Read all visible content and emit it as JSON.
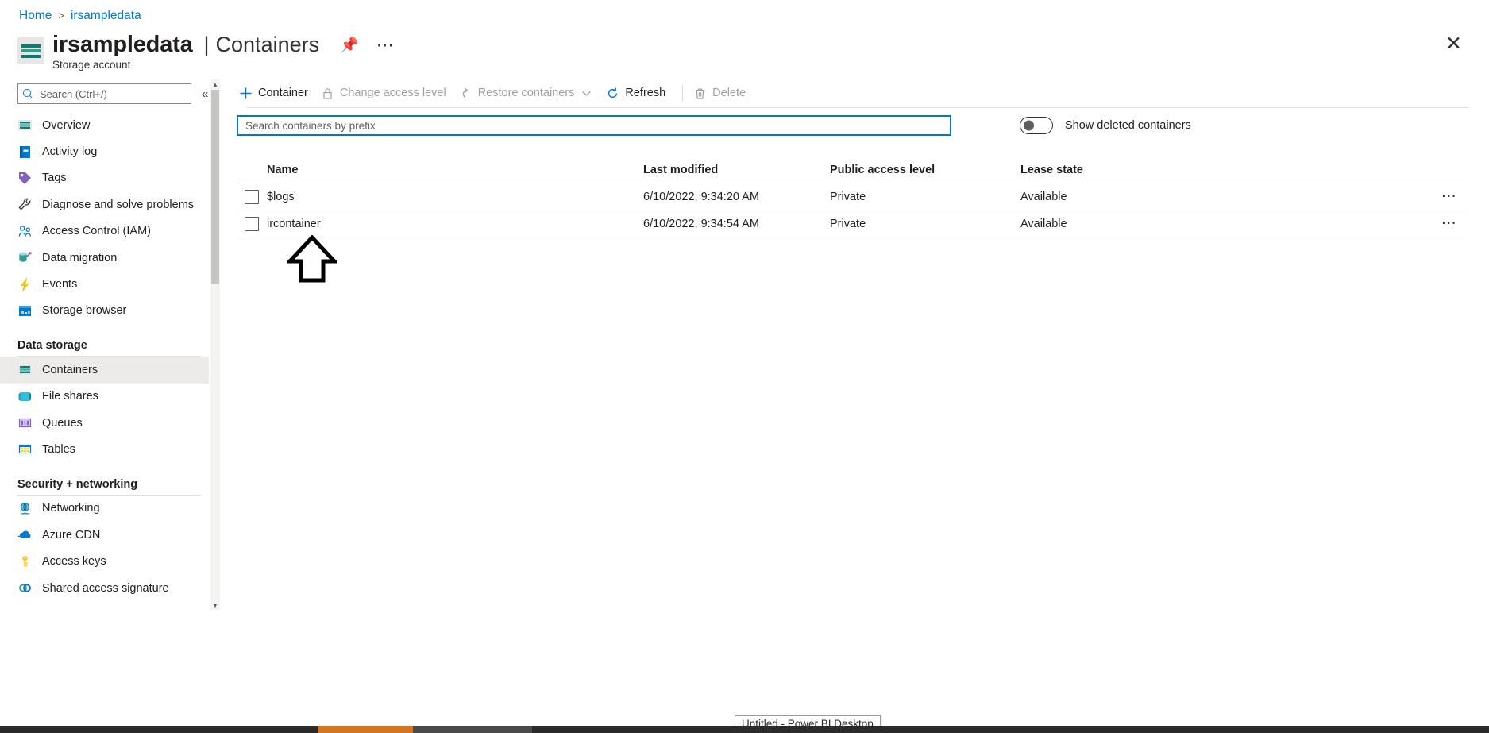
{
  "breadcrumb": {
    "home": "Home",
    "separator": ">",
    "current": "irsampledata"
  },
  "header": {
    "resource_name": "irsampledata",
    "pipe": "|",
    "page_title": "Containers",
    "subtitle": "Storage account",
    "pin_icon": "pin-icon",
    "more_icon": "ellipsis-icon",
    "close_icon": "close-icon"
  },
  "left_nav": {
    "search_placeholder": "Search (Ctrl+/)",
    "search_value": "",
    "collapse_icon": "chevron-double-left-icon",
    "items": [
      {
        "label": "Overview",
        "icon": "overview-icon",
        "selected": false
      },
      {
        "label": "Activity log",
        "icon": "activity-log-icon",
        "selected": false
      },
      {
        "label": "Tags",
        "icon": "tag-icon",
        "selected": false
      },
      {
        "label": "Diagnose and solve problems",
        "icon": "wrench-icon",
        "selected": false
      },
      {
        "label": "Access Control (IAM)",
        "icon": "people-icon",
        "selected": false
      },
      {
        "label": "Data migration",
        "icon": "data-migration-icon",
        "selected": false
      },
      {
        "label": "Events",
        "icon": "lightning-icon",
        "selected": false
      },
      {
        "label": "Storage browser",
        "icon": "storage-browser-icon",
        "selected": false
      }
    ],
    "groups": [
      {
        "title": "Data storage",
        "items": [
          {
            "label": "Containers",
            "icon": "containers-icon",
            "selected": true
          },
          {
            "label": "File shares",
            "icon": "file-share-icon",
            "selected": false
          },
          {
            "label": "Queues",
            "icon": "queues-icon",
            "selected": false
          },
          {
            "label": "Tables",
            "icon": "tables-icon",
            "selected": false
          }
        ]
      },
      {
        "title": "Security + networking",
        "items": [
          {
            "label": "Networking",
            "icon": "networking-icon",
            "selected": false
          },
          {
            "label": "Azure CDN",
            "icon": "cloud-icon",
            "selected": false
          },
          {
            "label": "Access keys",
            "icon": "key-icon",
            "selected": false
          },
          {
            "label": "Shared access signature",
            "icon": "link-icon",
            "selected": false
          }
        ]
      }
    ]
  },
  "command_bar": {
    "buttons": [
      {
        "label": "Container",
        "icon": "plus-icon",
        "disabled": false
      },
      {
        "label": "Change access level",
        "icon": "lock-icon",
        "disabled": true
      },
      {
        "label": "Restore containers",
        "icon": "undo-icon",
        "disabled": true,
        "has_chevron": true
      },
      {
        "label": "Refresh",
        "icon": "refresh-icon",
        "disabled": false
      },
      {
        "label": "Delete",
        "icon": "trash-icon",
        "disabled": true
      }
    ]
  },
  "filter_row": {
    "search_placeholder": "Search containers by prefix",
    "search_value": "",
    "toggle_label": "Show deleted containers",
    "toggle_on": false
  },
  "table": {
    "columns": [
      "Name",
      "Last modified",
      "Public access level",
      "Lease state"
    ],
    "rows": [
      {
        "name": "$logs",
        "last_modified": "6/10/2022, 9:34:20 AM",
        "public_access_level": "Private",
        "lease_state": "Available",
        "more_icon": "ellipsis-icon",
        "checked": false
      },
      {
        "name": "ircontainer",
        "last_modified": "6/10/2022, 9:34:54 AM",
        "public_access_level": "Private",
        "lease_state": "Available",
        "more_icon": "ellipsis-icon",
        "checked": false
      }
    ]
  },
  "annotation": {
    "arrow_icon": "up-arrow-annotation"
  },
  "taskbar": {
    "tooltip_text": "Untitled - Power BI Desktop"
  },
  "colors": {
    "accent": "#0078d4",
    "link": "#0078d4",
    "teal": "#2e9e8f",
    "selected_bg": "#edebe9",
    "border": "#e1dfdd",
    "disabled_text": "#a19f9d",
    "taskbar": "#2b2b2b",
    "taskbar_accent": "#d3761f"
  }
}
